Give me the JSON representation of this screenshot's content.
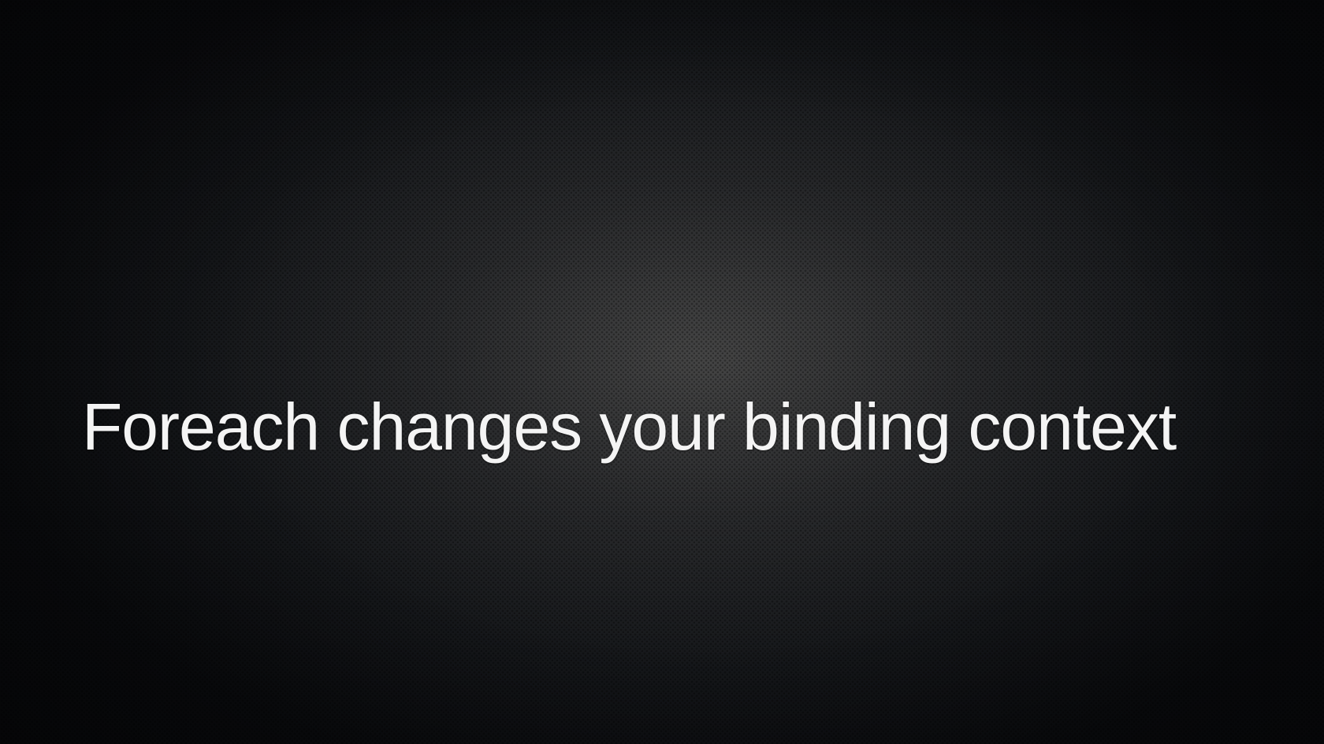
{
  "slide": {
    "title": "Foreach changes your binding context"
  },
  "colors": {
    "background_center": "#484848",
    "background_edge": "#0b0c0f",
    "text": "#f4f4f4"
  }
}
